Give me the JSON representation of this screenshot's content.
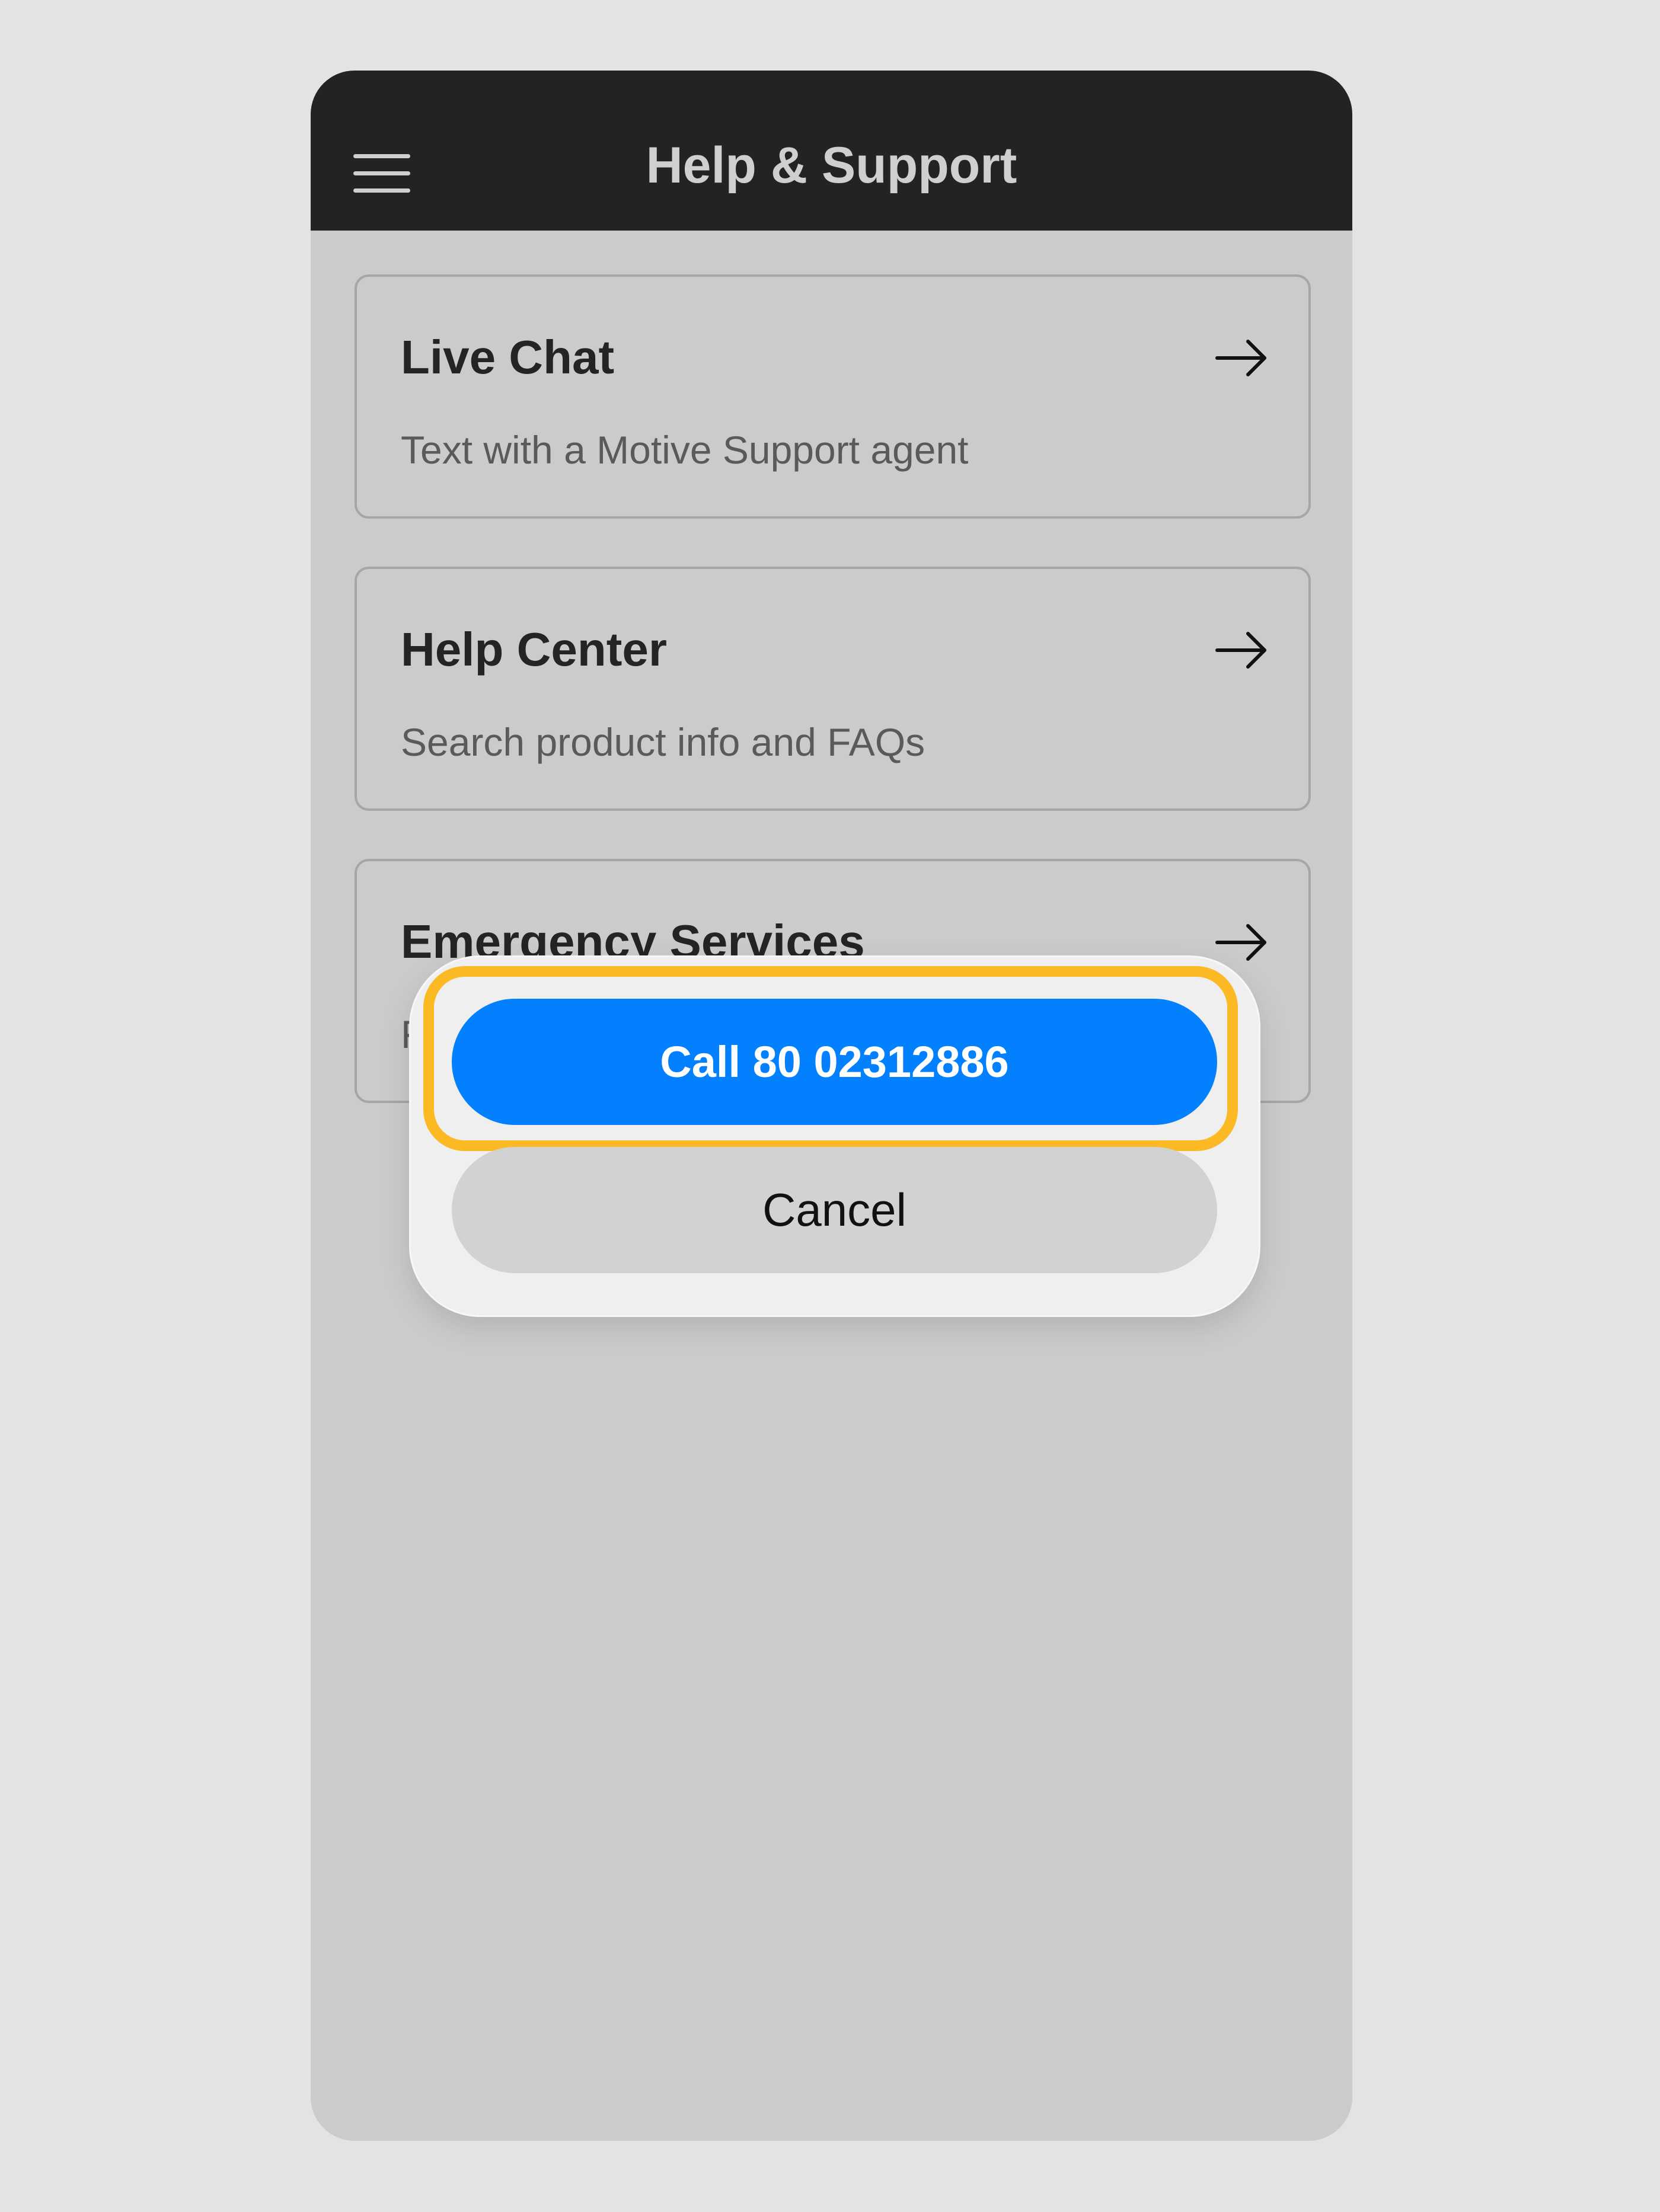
{
  "header": {
    "title": "Help & Support",
    "menu_icon": "hamburger-menu-icon"
  },
  "cards": [
    {
      "title": "Live Chat",
      "description": "Text with a Motive Support agent",
      "icon": "arrow-right-icon"
    },
    {
      "title": "Help Center",
      "description": "Search product info and FAQs",
      "icon": "arrow-right-icon"
    },
    {
      "title": "Emergency Services",
      "description": "F",
      "icon": "arrow-right-icon"
    }
  ],
  "dialog": {
    "call_label": "Call 80 02312886",
    "cancel_label": "Cancel"
  },
  "colors": {
    "header_bg": "#232323",
    "screen_bg": "#cbcbcb",
    "call_button": "#0280fe",
    "highlight": "#fbb924",
    "dialog_bg": "#efefef"
  }
}
